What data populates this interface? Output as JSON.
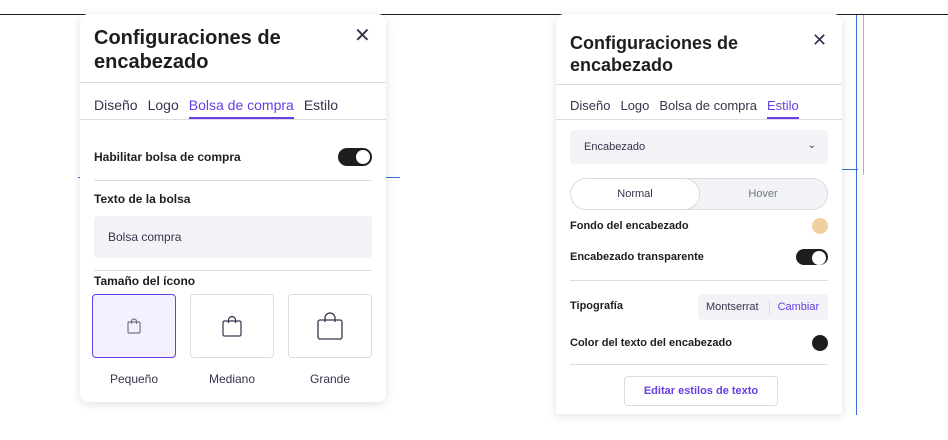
{
  "left_panel": {
    "title": "Configuraciones de encabezado",
    "tabs": [
      {
        "label": "Diseño",
        "active": false
      },
      {
        "label": "Logo",
        "active": false
      },
      {
        "label": "Bolsa de compra",
        "active": true
      },
      {
        "label": "Estilo",
        "active": false
      }
    ],
    "enable_label": "Habilitar bolsa de compra",
    "enable_on": true,
    "bag_text_label": "Texto de la bolsa",
    "bag_text_value": "Bolsa compra",
    "icon_size_label": "Tamaño del ícono",
    "sizes": [
      {
        "label": "Pequeño",
        "selected": true
      },
      {
        "label": "Mediano",
        "selected": false
      },
      {
        "label": "Grande",
        "selected": false
      }
    ]
  },
  "right_panel": {
    "title": "Configuraciones de encabezado",
    "tabs": [
      {
        "label": "Diseño",
        "active": false
      },
      {
        "label": "Logo",
        "active": false
      },
      {
        "label": "Bolsa de compra",
        "active": false
      },
      {
        "label": "Estilo",
        "active": true
      }
    ],
    "section_select": "Encabezado",
    "state_tabs": [
      {
        "label": "Normal",
        "active": true
      },
      {
        "label": "Hover",
        "active": false
      }
    ],
    "bg_label": "Fondo del encabezado",
    "bg_color": "#f0cfa0",
    "transparent_label": "Encabezado transparente",
    "transparent_on": true,
    "typography_label": "Tipografía",
    "font_name": "Montserrat",
    "font_change": "Cambiar",
    "text_color_label": "Color del texto del encabezado",
    "text_color": "#1d1e20",
    "edit_styles_button": "Editar estilos de texto"
  },
  "colors": {
    "accent": "#673de6",
    "border": "#dadce0",
    "input_bg": "#f2f3f6"
  }
}
